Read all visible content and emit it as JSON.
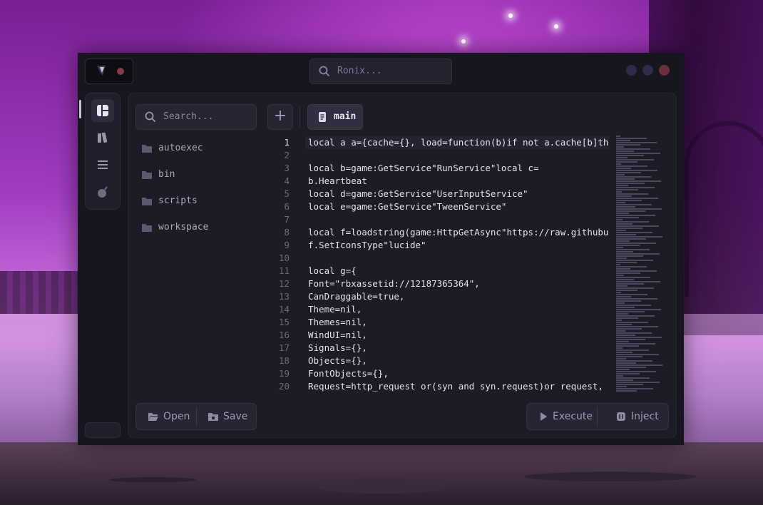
{
  "app": {
    "search_placeholder": "Ronix...",
    "window_dot_colors": [
      "#2d2c4a",
      "#2d2c4a",
      "#6e2f3c"
    ]
  },
  "sidebar": {
    "items": [
      {
        "icon": "layout-grid-icon",
        "active": true
      },
      {
        "icon": "library-icon",
        "active": false
      },
      {
        "icon": "sort-list-icon",
        "active": false
      },
      {
        "icon": "bomb-icon",
        "active": false
      }
    ]
  },
  "explorer": {
    "search_placeholder": "Search...",
    "add_label": "+",
    "folders": [
      "autoexec",
      "bin",
      "scripts",
      "workspace"
    ]
  },
  "tabs": [
    {
      "label": "main",
      "icon": "scroll-icon",
      "active": true
    }
  ],
  "editor": {
    "current_line": 1,
    "lines": [
      {
        "n": "1",
        "text": "local a a={cache={}, load=function(b)if not a.cache[b]then a"
      },
      {
        "n": "2",
        "text": ""
      },
      {
        "n": "3",
        "text": "local b=game:GetService\"RunService\"local c="
      },
      {
        "n": "4",
        "text": "b.Heartbeat"
      },
      {
        "n": "5",
        "text": "local d=game:GetService\"UserInputService\""
      },
      {
        "n": "6",
        "text": "local e=game:GetService\"TweenService\""
      },
      {
        "n": "7",
        "text": ""
      },
      {
        "n": "8",
        "text": "local f=loadstring(game:HttpGetAsync\"https://raw.githubuser"
      },
      {
        "n": "9",
        "text": "f.SetIconsType\"lucide\""
      },
      {
        "n": "10",
        "text": ""
      },
      {
        "n": "11",
        "text": "local g={"
      },
      {
        "n": "12",
        "text": "Font=\"rbxassetid://12187365364\","
      },
      {
        "n": "13",
        "text": "CanDraggable=true,"
      },
      {
        "n": "14",
        "text": "Theme=nil,"
      },
      {
        "n": "15",
        "text": "Themes=nil,"
      },
      {
        "n": "16",
        "text": "WindUI=nil,"
      },
      {
        "n": "17",
        "text": "Signals={},"
      },
      {
        "n": "18",
        "text": "Objects={},"
      },
      {
        "n": "19",
        "text": "FontObjects={},"
      },
      {
        "n": "20",
        "text": "Request=http_request or(syn and syn.request)or request,"
      }
    ]
  },
  "actions": {
    "open_label": "Open",
    "save_label": "Save",
    "execute_label": "Execute",
    "inject_label": "Inject"
  }
}
